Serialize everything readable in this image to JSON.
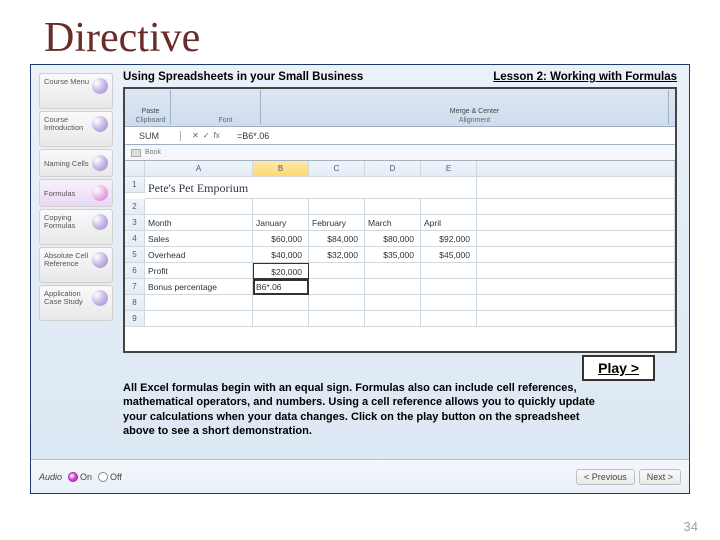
{
  "slide_title": "Directive",
  "header": {
    "course": "Using Spreadsheets in your Small Business",
    "lesson": "Lesson 2: Working with Formulas"
  },
  "menu": [
    {
      "label": "Course Menu"
    },
    {
      "label": "Course Introduction"
    },
    {
      "label": "Naming Cells"
    },
    {
      "label": "Formulas",
      "active": true
    },
    {
      "label": "Copying Formulas"
    },
    {
      "label": "Absolute Cell Reference"
    },
    {
      "label": "Application Case Study"
    }
  ],
  "ribbon": {
    "seg1_top": "Paste",
    "seg1": "Clipboard",
    "seg2": "Font",
    "seg3_top": "Merge & Center",
    "seg3": "Alignment"
  },
  "fx": {
    "name": "SUM",
    "icons": {
      "x": "✕",
      "check": "✓",
      "fx": "fx"
    },
    "value": "=B6*.06"
  },
  "book_label": "Book",
  "sheet": {
    "cols": [
      "A",
      "B",
      "C",
      "D",
      "E"
    ],
    "store": "Pete's Pet Emporium",
    "r3": {
      "a": "Month",
      "b": "January",
      "c": "February",
      "d": "March",
      "e": "April"
    },
    "r4": {
      "a": "Sales",
      "b": "$60,000",
      "c": "$84,000",
      "d": "$80,000",
      "e": "$92,000"
    },
    "r5": {
      "a": "Overhead",
      "b": "$40,000",
      "c": "$32,000",
      "d": "$35,000",
      "e": "$45,000"
    },
    "r6": {
      "a": "Profit",
      "b": "$20,000"
    },
    "r7": {
      "a": "Bonus percentage",
      "b": "B6*.06"
    }
  },
  "play_label": "Play >",
  "body": "All Excel formulas begin with an equal sign.  Formulas also can include cell references, mathematical operators, and numbers. Using a cell reference allows you to quickly update your calculations when your data changes. Click on the play button on the spreadsheet above to see a short demonstration.",
  "footer": {
    "audio": "Audio",
    "on": "On",
    "off": "Off",
    "prev": "< Previous",
    "next": "Next >"
  },
  "slide_num": "34"
}
